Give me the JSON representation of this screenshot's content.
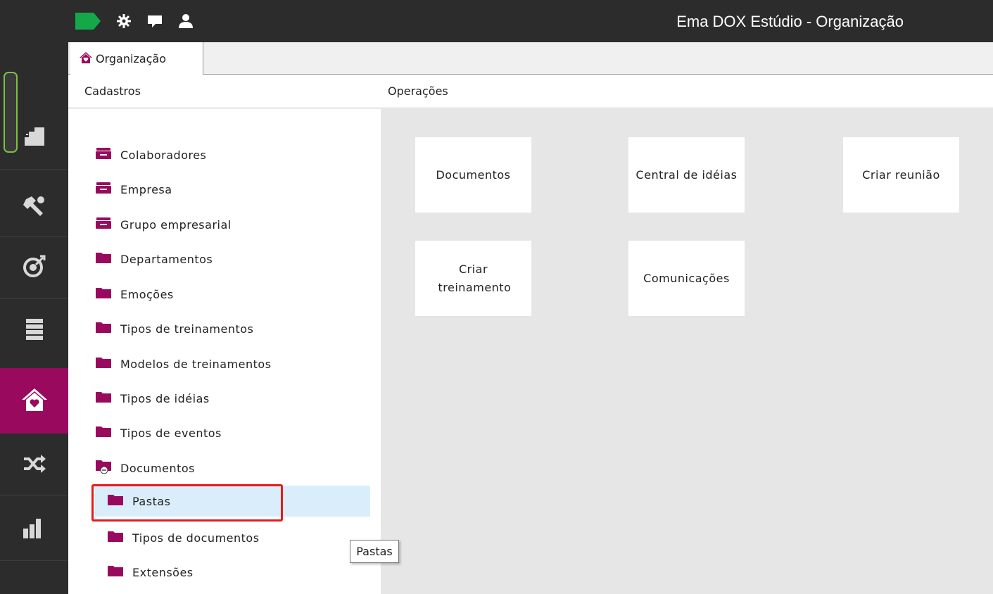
{
  "window": {
    "title": "Ema DOX Estúdio - Organização"
  },
  "tab": {
    "label": "Organização"
  },
  "sections": {
    "left_header": "Cadastros",
    "right_header": "Operações"
  },
  "tree": [
    {
      "label": "Colaboradores",
      "icon": "drawer-icon"
    },
    {
      "label": "Empresa",
      "icon": "drawer-icon"
    },
    {
      "label": "Grupo empresarial",
      "icon": "drawer-icon"
    },
    {
      "label": "Departamentos",
      "icon": "folder-icon"
    },
    {
      "label": "Emoções",
      "icon": "folder-icon"
    },
    {
      "label": "Tipos de treinamentos",
      "icon": "folder-icon"
    },
    {
      "label": "Modelos de treinamentos",
      "icon": "folder-icon"
    },
    {
      "label": "Tipos de idéias",
      "icon": "folder-icon"
    },
    {
      "label": "Tipos de eventos",
      "icon": "folder-icon"
    },
    {
      "label": "Documentos",
      "icon": "folder-collapse-icon"
    },
    {
      "label": "Pastas",
      "icon": "folder-icon",
      "selected": true
    },
    {
      "label": "Tipos de documentos",
      "icon": "folder-icon"
    },
    {
      "label": "Extensões",
      "icon": "folder-icon"
    }
  ],
  "operations": [
    {
      "label": "Documentos"
    },
    {
      "label": "Central de idéias"
    },
    {
      "label": "Criar reunião"
    },
    {
      "label": "Criar treinamento"
    },
    {
      "label": "Comunicações"
    }
  ],
  "tooltip": {
    "text": "Pastas"
  },
  "colors": {
    "brand": "#990a5e",
    "dark": "#2c2c2c",
    "accent_green": "#14a84a",
    "selection": "#d9eefa",
    "highlight": "#e8191b"
  }
}
